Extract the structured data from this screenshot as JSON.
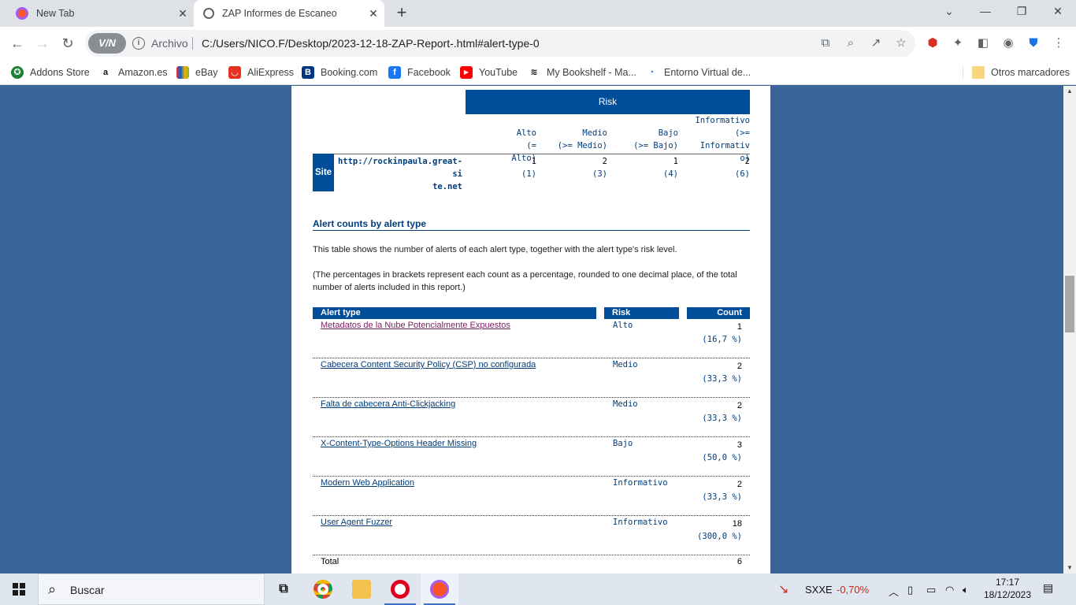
{
  "browser": {
    "tabs": [
      {
        "title": "New Tab",
        "icon": "brave-lion-icon"
      },
      {
        "title": "ZAP Informes de Escaneo",
        "icon": "globe-icon"
      }
    ],
    "vpn_label": "V/N",
    "security_label": "Archivo",
    "url": "C:/Users/NICO.F/Desktop/2023-12-18-ZAP-Report-.html#alert-type-0",
    "bookmarks": [
      {
        "label": "Addons Store",
        "color": "#1a7f37"
      },
      {
        "label": "Amazon.es",
        "color": "#111111"
      },
      {
        "label": "eBay",
        "color": "#e53238"
      },
      {
        "label": "AliExpress",
        "color": "#e43225"
      },
      {
        "label": "Booking.com",
        "color": "#003580"
      },
      {
        "label": "Facebook",
        "color": "#1877f2"
      },
      {
        "label": "YouTube",
        "color": "#ff0000"
      },
      {
        "label": "My Bookshelf - Ma...",
        "color": "#111111"
      },
      {
        "label": "Entorno Virtual de...",
        "color": "#1a73e8"
      }
    ],
    "other_bookmarks": "Otros marcadores"
  },
  "report": {
    "risk_header": "Risk",
    "columns": [
      {
        "lines": [
          "Alto",
          "(= Alto)"
        ]
      },
      {
        "lines": [
          "Medio",
          "(>= Medio)"
        ]
      },
      {
        "lines": [
          "Bajo",
          "(>= Bajo)"
        ]
      },
      {
        "lines": [
          "Informativo",
          "(>= Informativ",
          "o)"
        ]
      }
    ],
    "site_label": "Site",
    "site_url_lines": [
      "http://rockinpaula.great-si",
      "te.net"
    ],
    "site_values": [
      {
        "v": "1",
        "p": "(1)"
      },
      {
        "v": "2",
        "p": "(3)"
      },
      {
        "v": "1",
        "p": "(4)"
      },
      {
        "v": "2",
        "p": "(6)"
      }
    ],
    "section_title": "Alert counts by alert type",
    "para1": "This table shows the number of alerts of each alert type, together with the alert type's risk level.",
    "para2": "(The percentages in brackets represent each count as a percentage, rounded to one decimal place, of the total number of alerts included in this report.)",
    "table_headers": {
      "alert_type": "Alert type",
      "risk": "Risk",
      "count": "Count"
    },
    "alerts": [
      {
        "name": "Metadatos de la Nube Potencialmente Expuestos",
        "risk": "Alto",
        "count": "1",
        "pct": "(16,7 %)"
      },
      {
        "name": "Cabecera Content Security Policy (CSP) no configurada",
        "risk": "Medio",
        "count": "2",
        "pct": "(33,3 %)"
      },
      {
        "name": "Falta de cabecera Anti-Clickjacking",
        "risk": "Medio",
        "count": "2",
        "pct": "(33,3 %)"
      },
      {
        "name": "X-Content-Type-Options Header Missing",
        "risk": "Bajo",
        "count": "3",
        "pct": "(50,0 %)"
      },
      {
        "name": "Modern Web Application",
        "risk": "Informativo",
        "count": "2",
        "pct": "(33,3 %)"
      },
      {
        "name": "User Agent Fuzzer",
        "risk": "Informativo",
        "count": "18",
        "pct": "(300,0 %)"
      }
    ],
    "total_label": "Total",
    "total_value": "6"
  },
  "taskbar": {
    "search_placeholder": "Buscar",
    "stock_ticker": "SXXE",
    "stock_change": "-0,70%",
    "stock_color": "#c42b1c",
    "time": "17:17",
    "date": "18/12/2023"
  }
}
